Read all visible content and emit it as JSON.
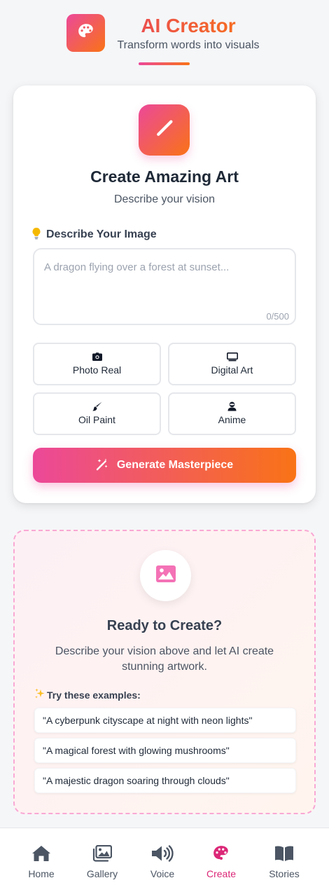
{
  "header": {
    "title": "AI Creator",
    "subtitle": "Transform words into visuals",
    "logo_icon": "palette-icon"
  },
  "colors": {
    "accent_pink": "#ec4899",
    "accent_orange": "#f97316",
    "active_nav": "#db2777"
  },
  "create_card": {
    "icon": "pencil-icon",
    "title": "Create Amazing Art",
    "subtitle": "Describe your vision",
    "prompt_label": "Describe Your Image",
    "prompt_label_icon": "lightbulb-icon",
    "prompt_value": "",
    "prompt_placeholder": "A dragon flying over a forest at sunset...",
    "char_count": "0/500",
    "styles": [
      {
        "label": "Photo Real",
        "icon": "camera-icon"
      },
      {
        "label": "Digital Art",
        "icon": "monitor-icon"
      },
      {
        "label": "Oil Paint",
        "icon": "paintbrush-icon"
      },
      {
        "label": "Anime",
        "icon": "user-ninja-icon"
      }
    ],
    "generate_label": "Generate Masterpiece",
    "generate_icon": "magic-wand-icon"
  },
  "ready_panel": {
    "icon": "image-icon",
    "title": "Ready to Create?",
    "description": "Describe your vision above and let AI create stunning artwork.",
    "examples_label": "Try these examples:",
    "examples_icon": "sparkles-icon",
    "examples": [
      "\"A cyberpunk cityscape at night with neon lights\"",
      "\"A magical forest with glowing mushrooms\"",
      "\"A majestic dragon soaring through clouds\""
    ]
  },
  "bottom_nav": {
    "items": [
      {
        "label": "Home",
        "icon": "home-icon"
      },
      {
        "label": "Gallery",
        "icon": "images-icon"
      },
      {
        "label": "Voice",
        "icon": "volume-icon"
      },
      {
        "label": "Create",
        "icon": "palette-icon",
        "active": true
      },
      {
        "label": "Stories",
        "icon": "book-open-icon"
      }
    ]
  }
}
